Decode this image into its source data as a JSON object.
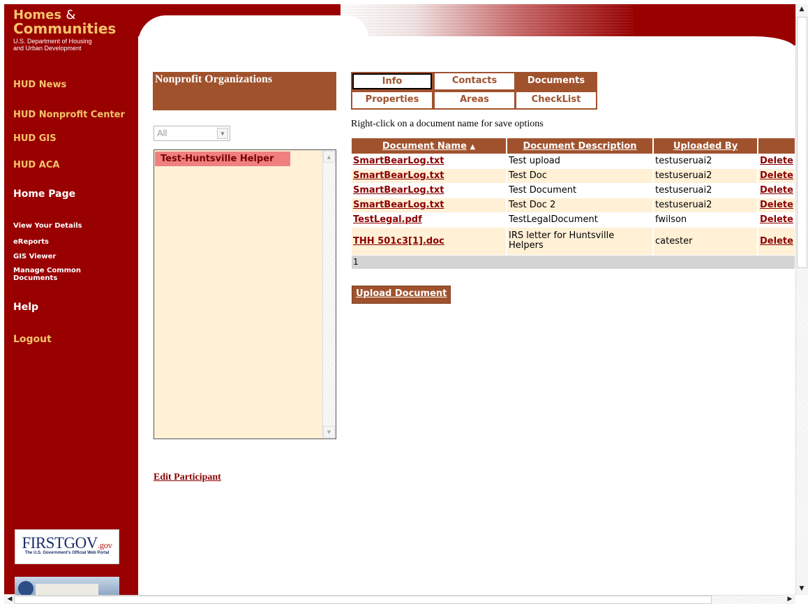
{
  "brand": {
    "line1": "Homes",
    "amp": "&",
    "line2": "Communities",
    "subtitle1": "U.S. Department of Housing",
    "subtitle2": "and Urban Development"
  },
  "sidebar": {
    "links": [
      {
        "label": "HUD News"
      },
      {
        "label": "HUD Nonprofit Center"
      },
      {
        "label": "HUD GIS"
      },
      {
        "label": "HUD ACA"
      },
      {
        "label": "Home Page"
      },
      {
        "label": "View Your Details"
      },
      {
        "label": "eReports"
      },
      {
        "label": "GIS Viewer"
      },
      {
        "label": "Manage Common Documents"
      },
      {
        "label": "Help"
      },
      {
        "label": "Logout"
      }
    ],
    "firstgov": {
      "title": "FIRSTGOV",
      "suffix": ".gov",
      "tagline": "The U.S. Government's Official Web Portal"
    }
  },
  "organizations": {
    "header": "Nonprofit Organizations",
    "filter_value": "All",
    "items": [
      {
        "label": "Test-Huntsville Helper"
      }
    ],
    "edit_link": "Edit Participant"
  },
  "tabs": [
    {
      "label": "Info"
    },
    {
      "label": "Contacts"
    },
    {
      "label": "Documents"
    },
    {
      "label": "Properties"
    },
    {
      "label": "Areas"
    },
    {
      "label": "CheckList"
    }
  ],
  "documents": {
    "hint": "Right-click on a document name for save options",
    "columns": [
      "Document Name",
      "Document Description",
      "Uploaded By",
      ""
    ],
    "sort_indicator": "▲",
    "rows": [
      {
        "name": "SmartBearLog.txt",
        "description": "Test upload",
        "uploaded_by": "testuseruai2",
        "action": "Delete"
      },
      {
        "name": "SmartBearLog.txt",
        "description": "Test Doc",
        "uploaded_by": "testuseruai2",
        "action": "Delete"
      },
      {
        "name": "SmartBearLog.txt",
        "description": "Test Document",
        "uploaded_by": "testuseruai2",
        "action": "Delete"
      },
      {
        "name": "SmartBearLog.txt",
        "description": "Test Doc 2",
        "uploaded_by": "testuseruai2",
        "action": "Delete"
      },
      {
        "name": "TestLegal.pdf",
        "description": "TestLegalDocument",
        "uploaded_by": "fwilson",
        "action": "Delete"
      },
      {
        "name": "THH 501c3[1].doc",
        "description": "IRS letter for Huntsville Helpers",
        "uploaded_by": "catester",
        "action": "Delete"
      }
    ],
    "pager": "1",
    "upload_button": "Upload Document"
  },
  "colors": {
    "sidebar": "#990000",
    "accent": "#a0522d",
    "link": "#8b0000",
    "row_alt": "#fff0d6",
    "highlight": "#f08080",
    "gold": "#f4c36b"
  },
  "icons": {
    "scroll_up": "▲",
    "scroll_down": "▼",
    "scroll_left": "◀",
    "scroll_right": "▶",
    "dropdown": "▼"
  }
}
